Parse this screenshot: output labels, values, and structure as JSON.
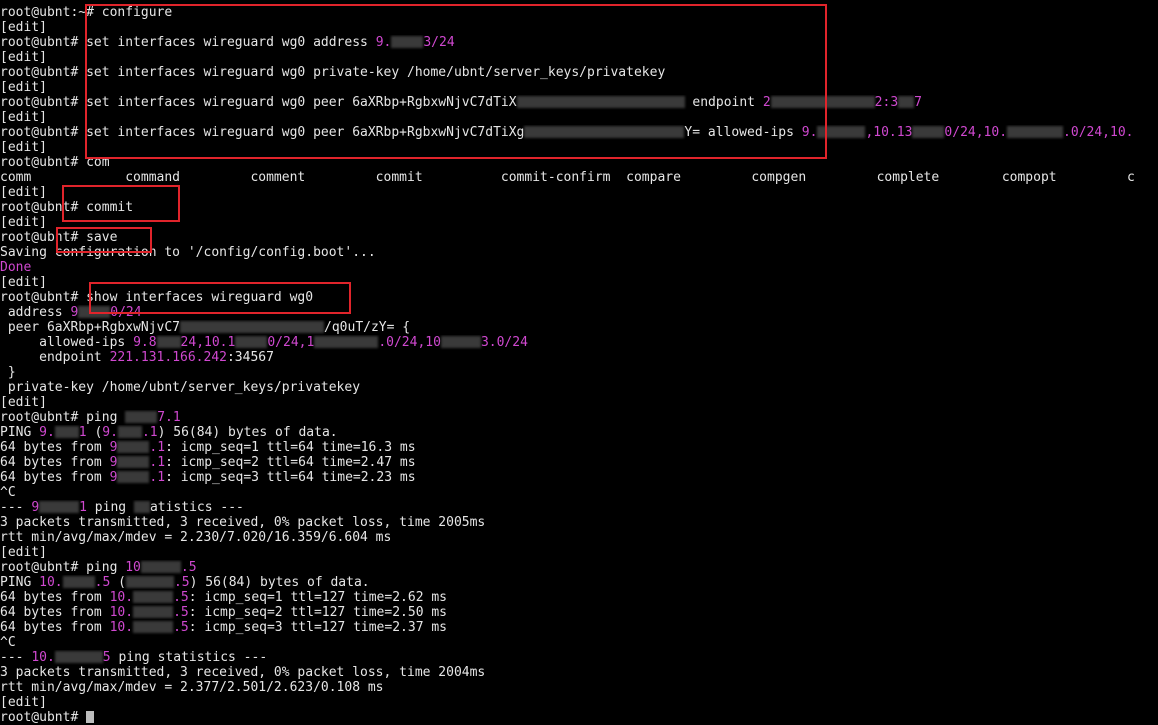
{
  "terminal": {
    "lines": [
      [
        {
          "t": "root@ubnt:~# configure"
        }
      ],
      [
        {
          "t": "[edit]"
        }
      ],
      [
        {
          "t": "root@ubnt# set interfaces wireguard wg0 address "
        },
        {
          "t": "9.",
          "c": "m"
        },
        {
          "blur": 4
        },
        {
          "t": "3/24",
          "c": "m"
        }
      ],
      [
        {
          "t": "[edit]"
        }
      ],
      [
        {
          "t": "root@ubnt# set interfaces wireguard wg0 private-key /home/ubnt/server_keys/privatekey"
        }
      ],
      [
        {
          "t": "[edit]"
        }
      ],
      [
        {
          "t": "root@ubnt# set interfaces wireguard wg0 peer 6aXRbp+RgbxwNjvC7dTiX"
        },
        {
          "blur": 21
        },
        {
          "t": " endpoint "
        },
        {
          "t": "2",
          "c": "m"
        },
        {
          "blur": 13
        },
        {
          "t": "2:3",
          "c": "m"
        },
        {
          "blur": 2
        },
        {
          "t": "7",
          "c": "m"
        }
      ],
      [
        {
          "t": "[edit]"
        }
      ],
      [
        {
          "t": "root@ubnt# set interfaces wireguard wg0 peer 6aXRbp+RgbxwNjvC7dTiXg"
        },
        {
          "blur": 20
        },
        {
          "t": "Y= allowed-ips "
        },
        {
          "t": "9.",
          "c": "m"
        },
        {
          "blur": 6
        },
        {
          "t": ",10.13",
          "c": "m"
        },
        {
          "blur": 4
        },
        {
          "t": "0/24,10.",
          "c": "m"
        },
        {
          "blur": 7
        },
        {
          "t": ".0/24,10.",
          "c": "m"
        }
      ],
      [
        {
          "t": "[edit]"
        }
      ],
      [
        {
          "t": "root@ubnt# com"
        }
      ],
      [
        {
          "t": "comm            command         comment         commit          commit-confirm  compare         compgen         complete        compopt         c"
        }
      ],
      [
        {
          "t": "[edit]"
        }
      ],
      [
        {
          "t": "root@ubnt# commit"
        }
      ],
      [
        {
          "t": "[edit]"
        }
      ],
      [
        {
          "t": "root@ubnt# save"
        }
      ],
      [
        {
          "t": "Saving configuration to '/config/config.boot'..."
        }
      ],
      [
        {
          "t": "Done",
          "c": "m"
        }
      ],
      [
        {
          "t": "[edit]"
        }
      ],
      [
        {
          "t": "root@ubnt# show interfaces wireguard wg0"
        }
      ],
      [
        {
          "t": " address "
        },
        {
          "t": "9",
          "c": "m"
        },
        {
          "blur": 4
        },
        {
          "t": "0/24",
          "c": "m"
        }
      ],
      [
        {
          "t": " peer 6aXRbp+RgbxwNjvC7"
        },
        {
          "blur": 18
        },
        {
          "t": "/q0uT/zY= {"
        }
      ],
      [
        {
          "t": "     allowed-ips "
        },
        {
          "t": "9.8",
          "c": "m"
        },
        {
          "blur": 3
        },
        {
          "t": "24,10.1",
          "c": "m"
        },
        {
          "blur": 4
        },
        {
          "t": "0/24,1",
          "c": "m"
        },
        {
          "blur": 8
        },
        {
          "t": ".0/24,10",
          "c": "m"
        },
        {
          "blur": 5
        },
        {
          "t": "3.0/24",
          "c": "m"
        }
      ],
      [
        {
          "t": "     endpoint "
        },
        {
          "t": "221.131.166.242",
          "c": "m"
        },
        {
          "t": ":34567"
        }
      ],
      [
        {
          "t": " }"
        }
      ],
      [
        {
          "t": " private-key /home/ubnt/server_keys/privatekey"
        }
      ],
      [
        {
          "t": "[edit]"
        }
      ],
      [
        {
          "t": "root@ubnt# ping "
        },
        {
          "blur": 4
        },
        {
          "t": "7.1",
          "c": "m"
        }
      ],
      [
        {
          "t": "PING "
        },
        {
          "t": "9.",
          "c": "m"
        },
        {
          "blur": 3
        },
        {
          "t": "1",
          "c": "m"
        },
        {
          "t": " ("
        },
        {
          "t": "9.",
          "c": "m"
        },
        {
          "blur": 3
        },
        {
          "t": ".1",
          "c": "m"
        },
        {
          "t": ") 56(84) bytes of data."
        }
      ],
      [
        {
          "t": "64 bytes from "
        },
        {
          "t": "9",
          "c": "m"
        },
        {
          "blur": 4
        },
        {
          "t": ".1",
          "c": "m"
        },
        {
          "t": ": icmp_seq=1 ttl=64 time=16.3 ms"
        }
      ],
      [
        {
          "t": "64 bytes from "
        },
        {
          "t": "9",
          "c": "m"
        },
        {
          "blur": 4
        },
        {
          "t": ".1",
          "c": "m"
        },
        {
          "t": ": icmp_seq=2 ttl=64 time=2.47 ms"
        }
      ],
      [
        {
          "t": "64 bytes from "
        },
        {
          "t": "9",
          "c": "m"
        },
        {
          "blur": 4
        },
        {
          "t": ".1",
          "c": "m"
        },
        {
          "t": ": icmp_seq=3 ttl=64 time=2.23 ms"
        }
      ],
      [
        {
          "t": "^C"
        }
      ],
      [
        {
          "t": "--- "
        },
        {
          "t": "9",
          "c": "m"
        },
        {
          "blur": 5
        },
        {
          "t": "1",
          "c": "m"
        },
        {
          "t": " ping "
        },
        {
          "blur": 2
        },
        {
          "t": "atistics ---"
        }
      ],
      [
        {
          "t": "3 packets transmitted, 3 received, 0% packet loss, time 2005ms"
        }
      ],
      [
        {
          "t": "rtt min/avg/max/mdev = 2.230/7.020/16.359/6.604 ms"
        }
      ],
      [
        {
          "t": "[edit]"
        }
      ],
      [
        {
          "t": "root@ubnt# ping "
        },
        {
          "t": "10",
          "c": "m"
        },
        {
          "blur": 5
        },
        {
          "t": ".5",
          "c": "m"
        }
      ],
      [
        {
          "t": "PING "
        },
        {
          "t": "10.",
          "c": "m"
        },
        {
          "blur": 4
        },
        {
          "t": ".5",
          "c": "m"
        },
        {
          "t": " ("
        },
        {
          "blur": 6
        },
        {
          "t": ".5",
          "c": "m"
        },
        {
          "t": ") 56(84) bytes of data."
        }
      ],
      [
        {
          "t": "64 bytes from "
        },
        {
          "t": "10.",
          "c": "m"
        },
        {
          "blur": 5
        },
        {
          "t": ".5",
          "c": "m"
        },
        {
          "t": ": icmp_seq=1 ttl=127 time=2.62 ms"
        }
      ],
      [
        {
          "t": "64 bytes from "
        },
        {
          "t": "10.",
          "c": "m"
        },
        {
          "blur": 5
        },
        {
          "t": ".5",
          "c": "m"
        },
        {
          "t": ": icmp_seq=2 ttl=127 time=2.50 ms"
        }
      ],
      [
        {
          "t": "64 bytes from "
        },
        {
          "t": "10.",
          "c": "m"
        },
        {
          "blur": 5
        },
        {
          "t": ".5",
          "c": "m"
        },
        {
          "t": ": icmp_seq=3 ttl=127 time=2.37 ms"
        }
      ],
      [
        {
          "t": "^C"
        }
      ],
      [
        {
          "t": "--- "
        },
        {
          "t": "10.",
          "c": "m"
        },
        {
          "blur": 6
        },
        {
          "t": "5",
          "c": "m"
        },
        {
          "t": " ping statistics ---"
        }
      ],
      [
        {
          "t": "3 packets transmitted, 3 received, 0% packet loss, time 2004ms"
        }
      ],
      [
        {
          "t": "rtt min/avg/max/mdev = 2.377/2.501/2.623/0.108 ms"
        }
      ],
      [
        {
          "t": "[edit]"
        }
      ],
      [
        {
          "t": "root@ubnt# "
        },
        {
          "cursor": true
        }
      ]
    ]
  },
  "colors": {
    "background": "#000000",
    "text": "#e6e6e6",
    "highlight": "#d048d0",
    "annotation_box": "#e0242b"
  }
}
